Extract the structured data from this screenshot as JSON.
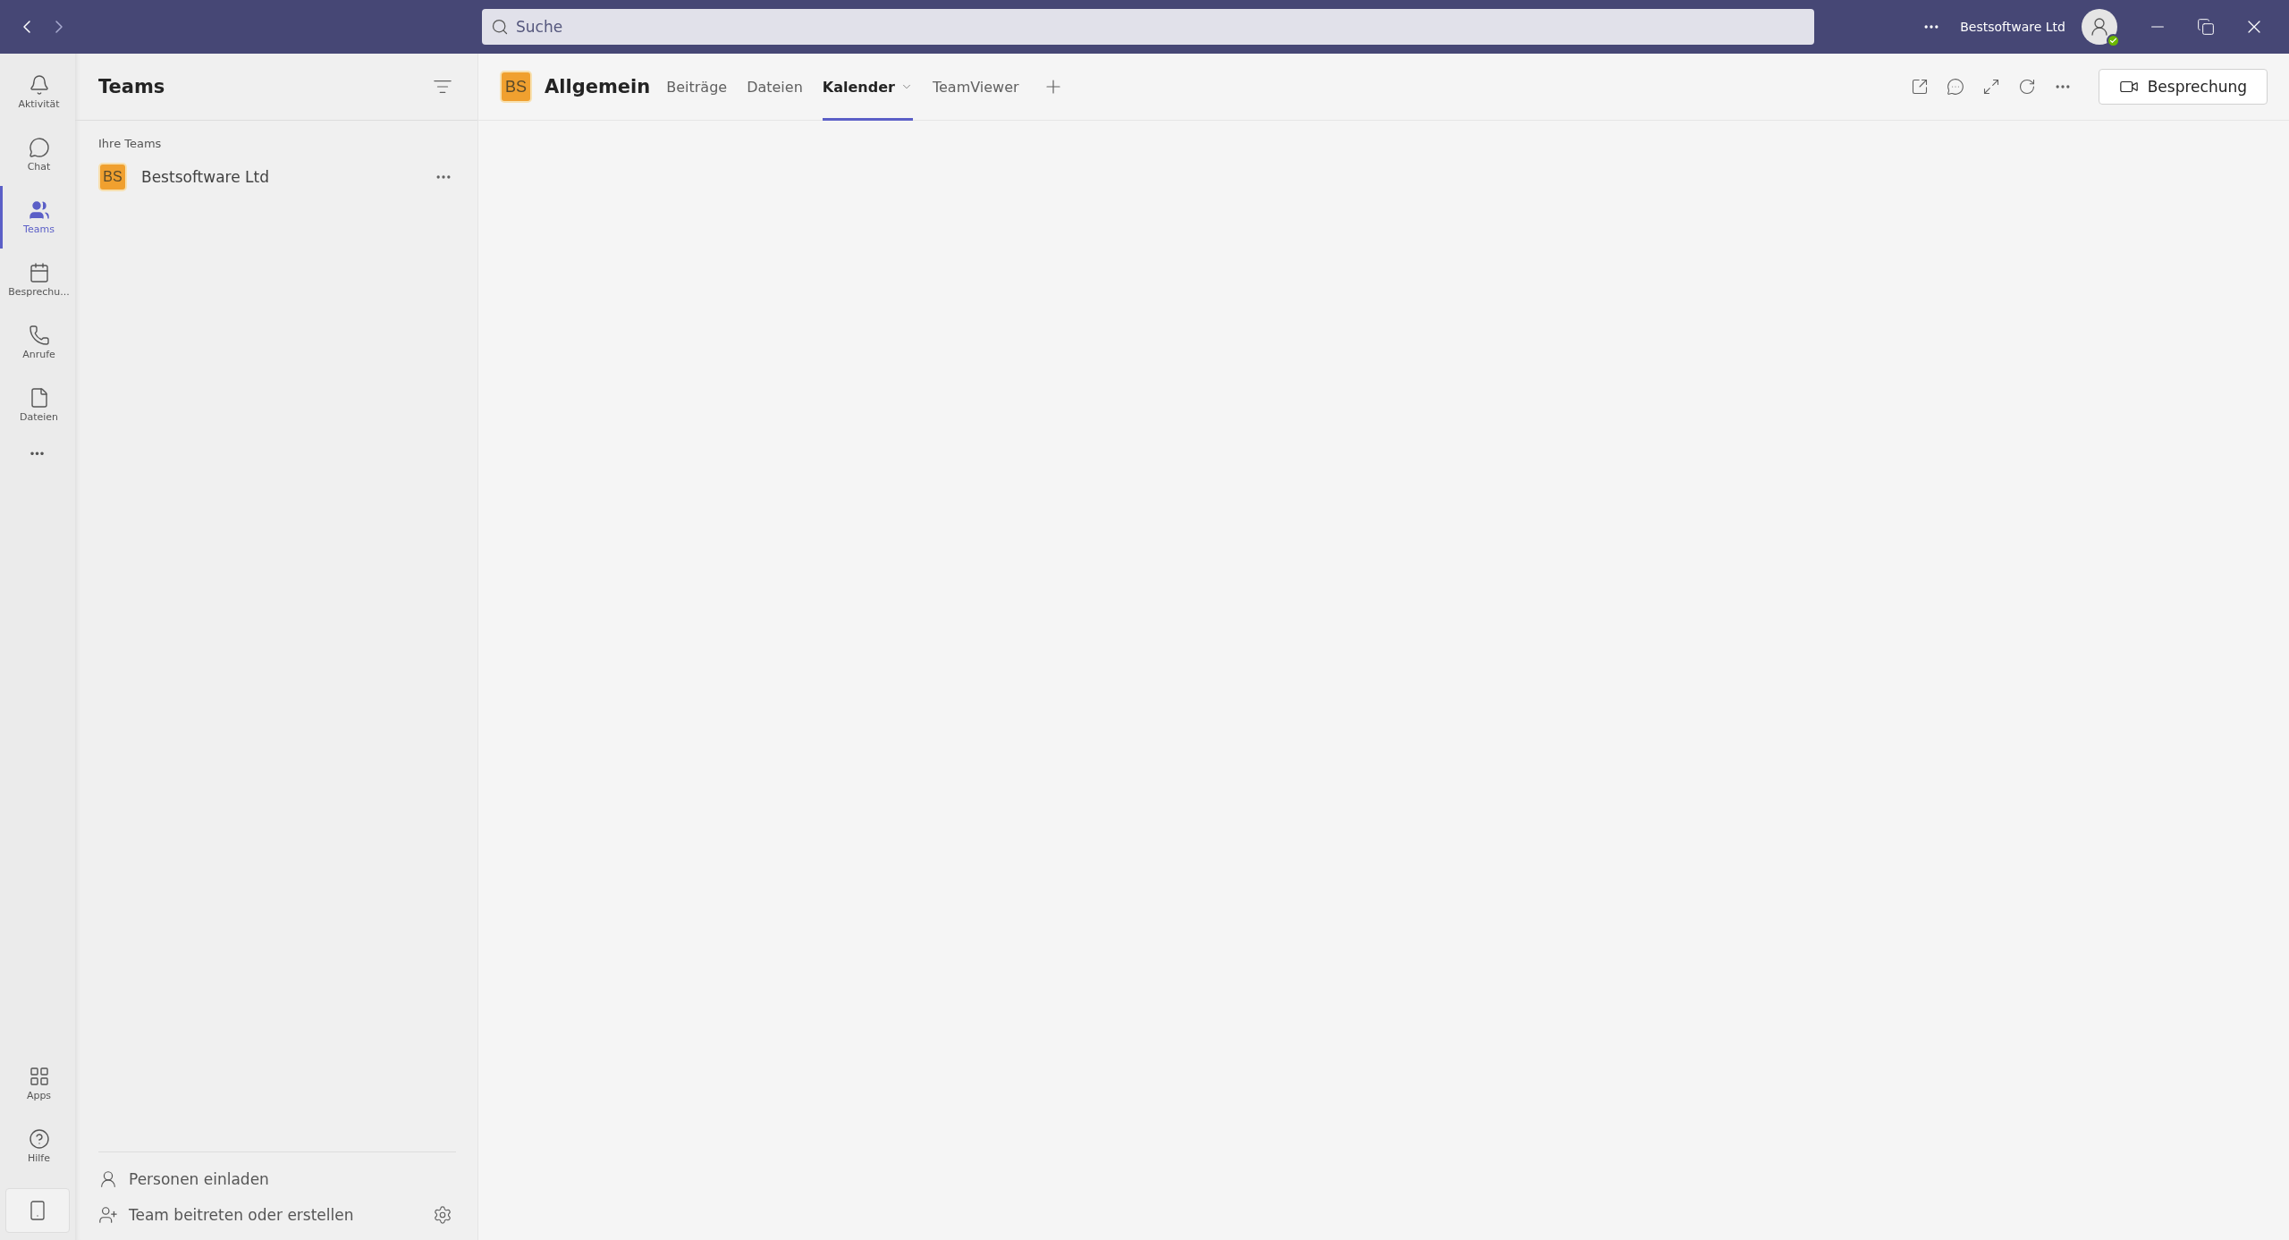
{
  "title_bar": {
    "search": {
      "placeholder": "Suche"
    },
    "account": "Bestsoftware Ltd"
  },
  "app_bar": {
    "items": [
      {
        "label": "Aktivität",
        "selected": false
      },
      {
        "label": "Chat",
        "selected": false
      },
      {
        "label": "Teams",
        "selected": true
      },
      {
        "label": "Besprechu...",
        "selected": false
      },
      {
        "label": "Anrufe",
        "selected": false
      },
      {
        "label": "Dateien",
        "selected": false
      }
    ],
    "more": "•••",
    "bottom_items": [
      {
        "label": "Apps",
        "selected": false
      },
      {
        "label": "Hilfe",
        "selected": false
      }
    ]
  },
  "sidebar": {
    "title": "Teams",
    "section": "Ihre Teams",
    "teams": [
      {
        "initials": "BS",
        "name": "Bestsoftware Ltd"
      }
    ],
    "footer": [
      "Personen einladen",
      "Team beitreten oder erstellen"
    ]
  },
  "channel": {
    "initials": "BS",
    "name": "Allgemein",
    "tabs": [
      {
        "label": "Beiträge",
        "selected": false,
        "menu": false
      },
      {
        "label": "Dateien",
        "selected": false,
        "menu": false
      },
      {
        "label": "Kalender",
        "selected": true,
        "menu": true
      },
      {
        "label": "TeamViewer",
        "selected": false,
        "menu": false
      }
    ],
    "meet_button": "Besprechung"
  }
}
